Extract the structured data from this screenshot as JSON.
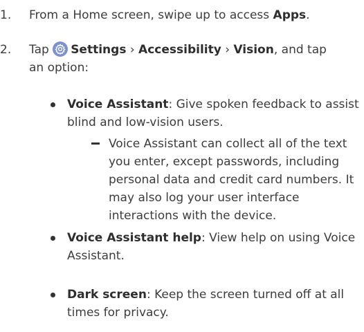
{
  "steps": [
    {
      "number": "1.",
      "prefix": "From a Home screen, swipe up to access ",
      "bold": "Apps",
      "suffix": "."
    },
    {
      "number": "2.",
      "tap": "Tap ",
      "icon": "settings-gear-icon",
      "settings": "Settings",
      "sep1": " › ",
      "accessibility": "Accessibility",
      "sep2": " › ",
      "vision": "Vision",
      "tail": ", and tap an option:"
    }
  ],
  "options": [
    {
      "name": "Voice Assistant",
      "desc": ": Give spoken feedback to assist blind and low-vision users."
    },
    {
      "name": "Voice Assistant help",
      "desc": ": View help on using Voice Assistant."
    },
    {
      "name": "Dark screen",
      "desc": ": Keep the screen turned off at all times for privacy."
    }
  ],
  "note": "Voice Assistant can collect all of the text you enter, except passwords, including personal data and credit card numbers. It may also log your user interface interactions with the device.",
  "colors": {
    "text": "#3c3c3c",
    "icon_bg": "#7c8fcf"
  }
}
